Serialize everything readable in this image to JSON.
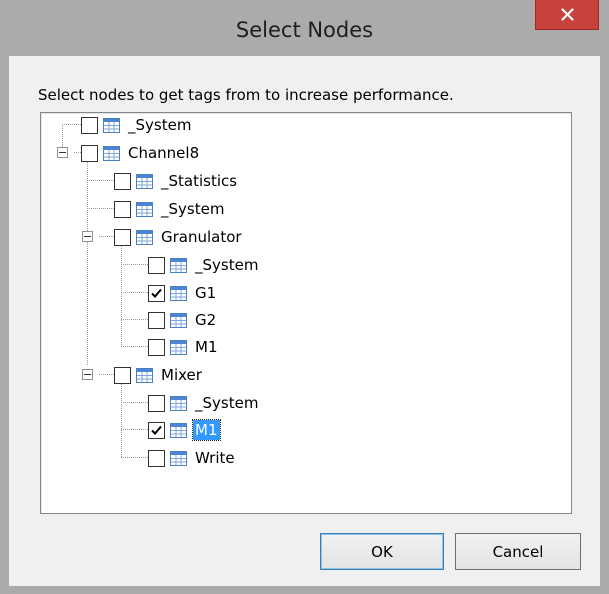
{
  "window": {
    "title": "Select Nodes",
    "close_label": "×"
  },
  "dialog": {
    "instruction": "Select nodes to get tags from to increase performance."
  },
  "tree": {
    "nodes": [
      {
        "label": "_System",
        "checked": false,
        "selected": false
      },
      {
        "label": "Channel8",
        "checked": false,
        "selected": false
      },
      {
        "label": "_Statistics",
        "checked": false,
        "selected": false
      },
      {
        "label": "_System",
        "checked": false,
        "selected": false
      },
      {
        "label": "Granulator",
        "checked": false,
        "selected": false
      },
      {
        "label": "_System",
        "checked": false,
        "selected": false
      },
      {
        "label": "G1",
        "checked": true,
        "selected": false
      },
      {
        "label": "G2",
        "checked": false,
        "selected": false
      },
      {
        "label": "M1",
        "checked": false,
        "selected": false
      },
      {
        "label": "Mixer",
        "checked": false,
        "selected": false
      },
      {
        "label": "_System",
        "checked": false,
        "selected": false
      },
      {
        "label": "M1",
        "checked": true,
        "selected": true
      },
      {
        "label": "Write",
        "checked": false,
        "selected": false
      }
    ]
  },
  "buttons": {
    "ok_label": "OK",
    "cancel_label": "Cancel"
  },
  "colors": {
    "title_bar": "#ababab",
    "close_button": "#c7423c",
    "selection": "#3399ff",
    "dialog_background": "#f0f0f0"
  },
  "icons": {
    "node": "table-icon",
    "close": "close-icon",
    "expander": "collapse-icon",
    "check": "checkmark-icon"
  }
}
